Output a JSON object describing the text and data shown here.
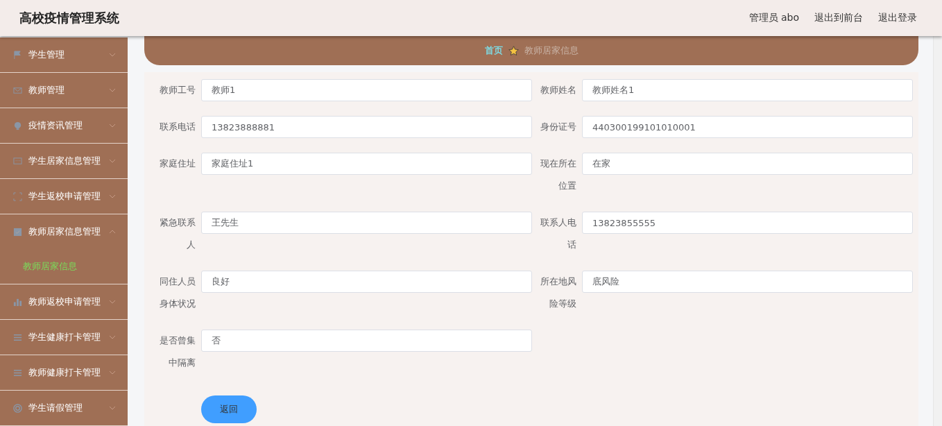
{
  "header": {
    "title": "高校疫情管理系统",
    "user": "管理员 abo",
    "links": [
      "退出到前台",
      "退出登录"
    ]
  },
  "sidebar": {
    "items": [
      {
        "label": "学生管理",
        "expanded": false
      },
      {
        "label": "教师管理",
        "expanded": false
      },
      {
        "label": "疫情资讯管理",
        "expanded": false
      },
      {
        "label": "学生居家信息管理",
        "expanded": false
      },
      {
        "label": "学生返校申请管理",
        "expanded": false
      },
      {
        "label": "教师居家信息管理",
        "expanded": true,
        "children": [
          {
            "label": "教师居家信息",
            "selected": true
          }
        ]
      },
      {
        "label": "教师返校申请管理",
        "expanded": false
      },
      {
        "label": "学生健康打卡管理",
        "expanded": false
      },
      {
        "label": "教师健康打卡管理",
        "expanded": false
      },
      {
        "label": "学生请假管理",
        "expanded": false
      }
    ]
  },
  "breadcrumb": {
    "home": "首页",
    "current": "教师居家信息"
  },
  "form": {
    "fields": [
      {
        "label": "教师工号",
        "value": "教师1"
      },
      {
        "label": "教师姓名",
        "value": "教师姓名1"
      },
      {
        "label": "联系电话",
        "value": "13823888881"
      },
      {
        "label": "身份证号",
        "value": "440300199101010001"
      },
      {
        "label": "家庭住址",
        "value": "家庭住址1"
      },
      {
        "label": "现在所在位置",
        "value": "在家"
      },
      {
        "label": "紧急联系人",
        "value": "王先生"
      },
      {
        "label": "联系人电话",
        "value": "13823855555"
      },
      {
        "label": "同住人员身体状况",
        "value": "良好"
      },
      {
        "label": "所在地风险等级",
        "value": "底风险"
      },
      {
        "label": "是否曾集中隔离",
        "value": "否"
      }
    ],
    "buttons": [
      "返回"
    ]
  }
}
